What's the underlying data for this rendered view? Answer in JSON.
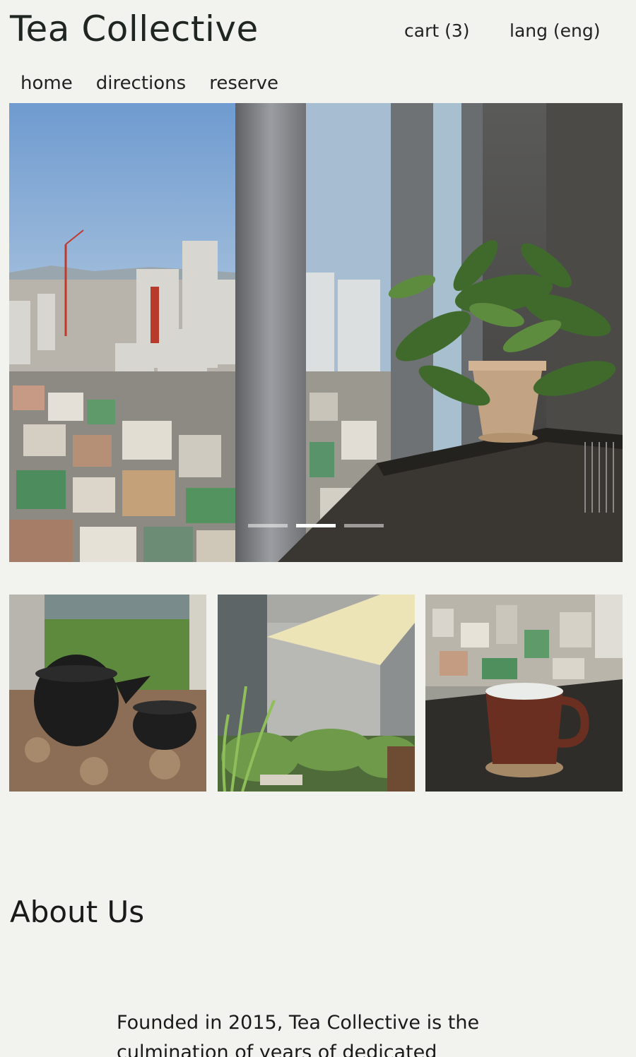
{
  "header": {
    "brand": "Tea Collective",
    "cart_label": "cart (3)",
    "lang_label": "lang (eng)"
  },
  "nav": {
    "items": [
      {
        "label": "home"
      },
      {
        "label": "directions"
      },
      {
        "label": "reserve"
      }
    ]
  },
  "hero": {
    "slide_count": 3,
    "active_slide": 2
  },
  "about": {
    "title": "About Us",
    "text": "Founded in 2015, Tea Collective is the culmination of years of dedicated"
  },
  "colors": {
    "background": "#f2f3ef",
    "text": "#1f2520"
  }
}
